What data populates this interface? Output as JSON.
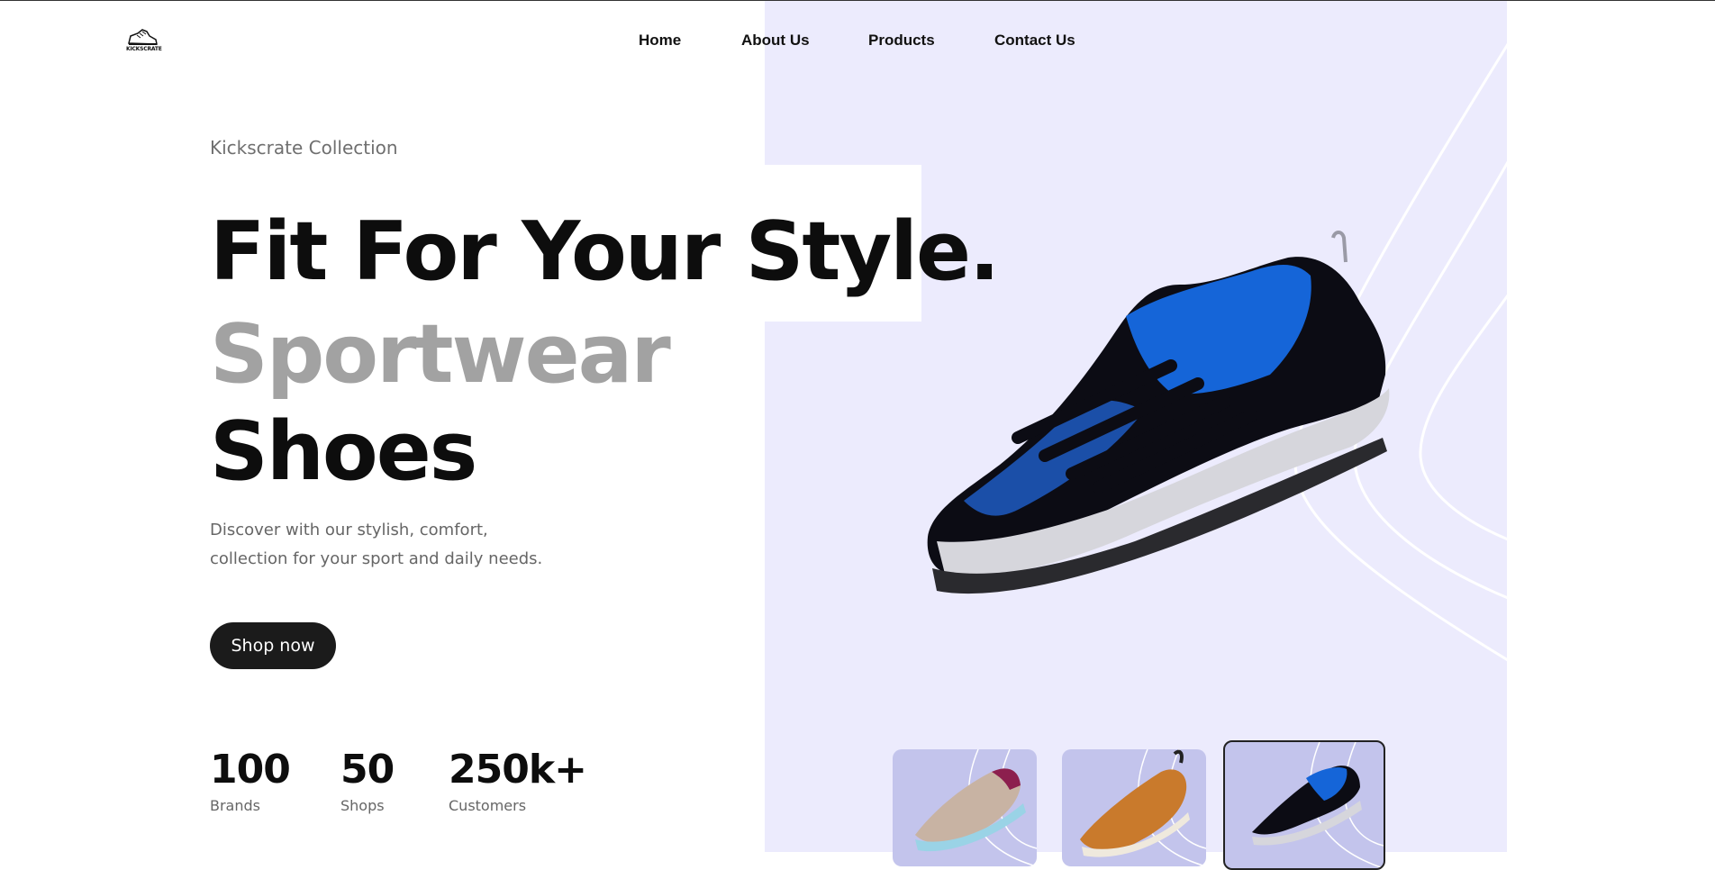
{
  "brand": {
    "logo_text": "KICKSCRATE"
  },
  "nav": {
    "items": [
      "Home",
      "About Us",
      "Products",
      "Contact Us"
    ]
  },
  "hero": {
    "kicker": "Kickscrate Collection",
    "title_line1": "Fit For Your Style.",
    "title_line2": "Sportwear",
    "title_line3": "Shoes",
    "description_line1": "Discover with our stylish, comfort,",
    "description_line2": "collection for your sport and daily needs.",
    "cta_label": "Shop now"
  },
  "stats": [
    {
      "value": "100",
      "label": "Brands"
    },
    {
      "value": "50",
      "label": "Shops"
    },
    {
      "value": "250k+",
      "label": "Customers"
    }
  ],
  "thumbnails": [
    {
      "icon": "beige-sneaker-icon",
      "active": false
    },
    {
      "icon": "tan-sneaker-icon",
      "active": false
    },
    {
      "icon": "blue-trail-shoe-icon",
      "active": true
    }
  ],
  "colors": {
    "hero_bg": "#ecebfd",
    "thumb_bg": "#c3c4ec",
    "cta_bg": "#1b1b1b",
    "shoe_blue": "#1565d8"
  }
}
